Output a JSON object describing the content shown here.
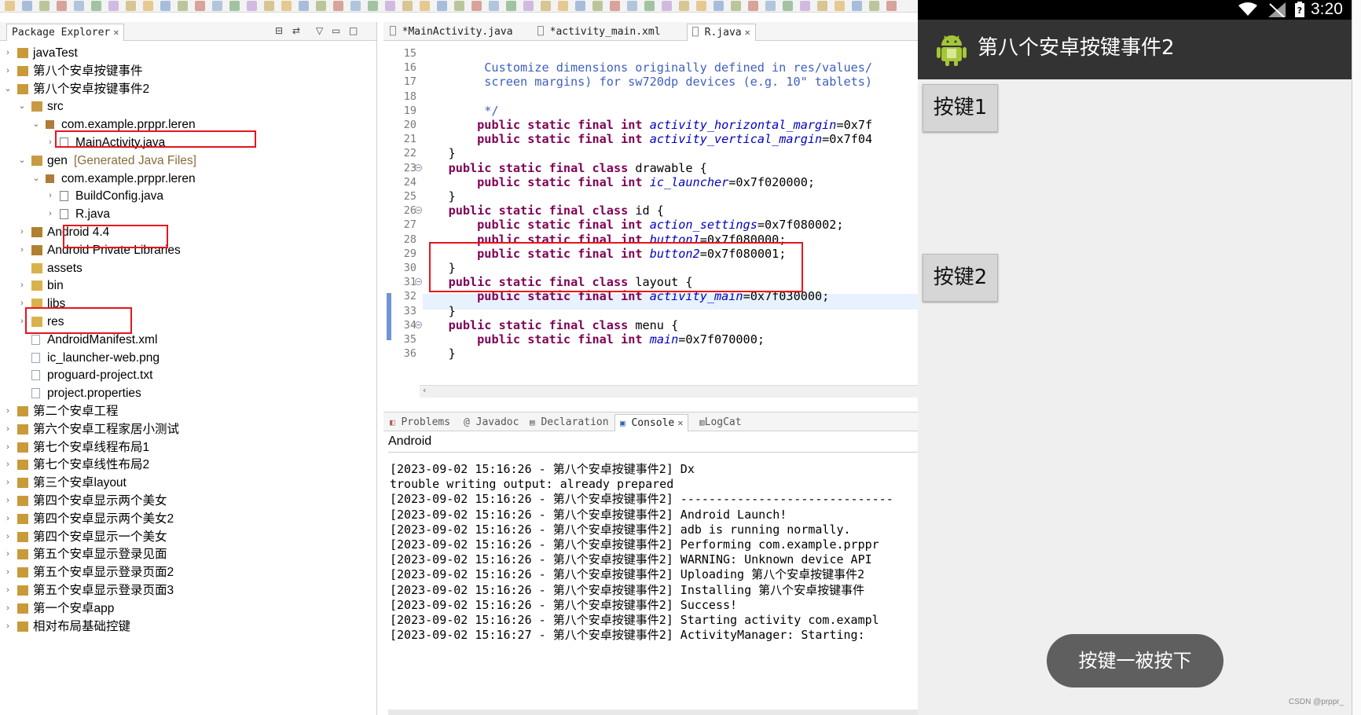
{
  "package_explorer": {
    "tab_label": "Package Explorer",
    "rows": [
      {
        "label": "javaTest",
        "sub": ""
      },
      {
        "label": "第八个安卓按键事件",
        "sub": ""
      },
      {
        "label": "第八个安卓按键事件2",
        "sub": ""
      },
      {
        "label": "src",
        "sub": ""
      },
      {
        "label": "com.example.prppr.leren",
        "sub": ""
      },
      {
        "label": "MainActivity.java",
        "sub": ""
      },
      {
        "label": "gen",
        "sub": "[Generated Java Files]"
      },
      {
        "label": "com.example.prppr.leren",
        "sub": ""
      },
      {
        "label": "BuildConfig.java",
        "sub": ""
      },
      {
        "label": "R.java",
        "sub": ""
      },
      {
        "label": "Android 4.4",
        "sub": ""
      },
      {
        "label": "Android Private Libraries",
        "sub": ""
      },
      {
        "label": "assets",
        "sub": ""
      },
      {
        "label": "bin",
        "sub": ""
      },
      {
        "label": "libs",
        "sub": ""
      },
      {
        "label": "res",
        "sub": ""
      },
      {
        "label": "AndroidManifest.xml",
        "sub": ""
      },
      {
        "label": "ic_launcher-web.png",
        "sub": ""
      },
      {
        "label": "proguard-project.txt",
        "sub": ""
      },
      {
        "label": "project.properties",
        "sub": ""
      },
      {
        "label": "第二个安卓工程",
        "sub": ""
      },
      {
        "label": "第六个安卓工程家居小测试",
        "sub": ""
      },
      {
        "label": "第七个安卓线程布局1",
        "sub": ""
      },
      {
        "label": "第七个安卓线性布局2",
        "sub": ""
      },
      {
        "label": "第三个安卓layout",
        "sub": ""
      },
      {
        "label": "第四个安卓显示两个美女",
        "sub": ""
      },
      {
        "label": "第四个安卓显示两个美女2",
        "sub": ""
      },
      {
        "label": "第四个安卓显示一个美女",
        "sub": ""
      },
      {
        "label": "第五个安卓显示登录见面",
        "sub": ""
      },
      {
        "label": "第五个安卓显示登录页面2",
        "sub": ""
      },
      {
        "label": "第五个安卓显示登录页面3",
        "sub": ""
      },
      {
        "label": "第一个安卓app",
        "sub": ""
      },
      {
        "label": "相对布局基础控键",
        "sub": ""
      }
    ]
  },
  "editor": {
    "tabs": [
      {
        "label": "*MainActivity.java"
      },
      {
        "label": "*activity_main.xml"
      },
      {
        "label": "R.java"
      }
    ],
    "lines": [
      {
        "n": "15",
        "t": ""
      },
      {
        "n": "16",
        "t": "         Customize dimensions originally defined in res/values/"
      },
      {
        "n": "17",
        "t": "         screen margins) for sw720dp devices (e.g. 10\" tablets)"
      },
      {
        "n": "18",
        "t": ""
      },
      {
        "n": "19",
        "t": "         */"
      },
      {
        "n": "20",
        "t": "        public static final int activity_horizontal_margin=0x7f"
      },
      {
        "n": "21",
        "t": "        public static final int activity_vertical_margin=0x7f04"
      },
      {
        "n": "22",
        "t": "    }"
      },
      {
        "n": "23",
        "t": "    public static final class drawable {"
      },
      {
        "n": "24",
        "t": "        public static final int ic_launcher=0x7f020000;"
      },
      {
        "n": "25",
        "t": "    }"
      },
      {
        "n": "26",
        "t": "    public static final class id {"
      },
      {
        "n": "27",
        "t": "        public static final int action_settings=0x7f080002;"
      },
      {
        "n": "28",
        "t": "        public static final int button1=0x7f080000;"
      },
      {
        "n": "29",
        "t": "        public static final int button2=0x7f080001;"
      },
      {
        "n": "30",
        "t": "    }"
      },
      {
        "n": "31",
        "t": "    public static final class layout {"
      },
      {
        "n": "32",
        "t": "        public static final int activity_main=0x7f030000;"
      },
      {
        "n": "33",
        "t": "    }"
      },
      {
        "n": "34",
        "t": "    public static final class menu {"
      },
      {
        "n": "35",
        "t": "        public static final int main=0x7f070000;"
      },
      {
        "n": "36",
        "t": "    }"
      }
    ]
  },
  "bottom_panel": {
    "tabs": [
      {
        "label": "Problems"
      },
      {
        "label": "Javadoc"
      },
      {
        "label": "Declaration"
      },
      {
        "label": "Console"
      },
      {
        "label": "LogCat"
      }
    ],
    "console_title": "Android",
    "lines": [
      "[2023-09-02 15:16:26 - 第八个安卓按键事件2] Dx",
      "trouble writing output: already prepared",
      "[2023-09-02 15:16:26 - 第八个安卓按键事件2] ------------------------------",
      "[2023-09-02 15:16:26 - 第八个安卓按键事件2] Android Launch!",
      "[2023-09-02 15:16:26 - 第八个安卓按键事件2] adb is running normally.",
      "[2023-09-02 15:16:26 - 第八个安卓按键事件2] Performing com.example.prppr",
      "[2023-09-02 15:16:26 - 第八个安卓按键事件2] WARNING: Unknown device API",
      "[2023-09-02 15:16:26 - 第八个安卓按键事件2] Uploading 第八个安卓按键事件2",
      "[2023-09-02 15:16:26 - 第八个安卓按键事件2] Installing 第八个安卓按键事件",
      "[2023-09-02 15:16:26 - 第八个安卓按键事件2] Success!",
      "[2023-09-02 15:16:26 - 第八个安卓按键事件2] Starting activity com.exampl",
      "[2023-09-02 15:16:27 - 第八个安卓按键事件2] ActivityManager: Starting:"
    ]
  },
  "emulator": {
    "clock": "3:20",
    "app_title": "第八个安卓按键事件2",
    "button1": "按键1",
    "button2": "按键2",
    "toast": "按键一被按下"
  },
  "watermark": "CSDN @prppr_",
  "colors": {
    "highlight_box": "#e8141e",
    "java_keyword": "#7f0055",
    "java_field": "#0000c0",
    "java_comment": "#3f5fbf",
    "action_bar": "#333333"
  }
}
